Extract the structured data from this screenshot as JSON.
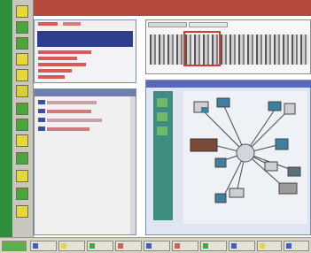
{
  "window": {
    "title": ""
  },
  "taskbar": {
    "start_label": "",
    "buttons": [
      "",
      "",
      "",
      "",
      "",
      "",
      "",
      "",
      "",
      ""
    ]
  },
  "colors": {
    "accent_red": "#b64a3c",
    "navy": "#2f3e8c",
    "teal": "#3f8c80",
    "green": "#49a63f",
    "yellow": "#e8df2e"
  }
}
